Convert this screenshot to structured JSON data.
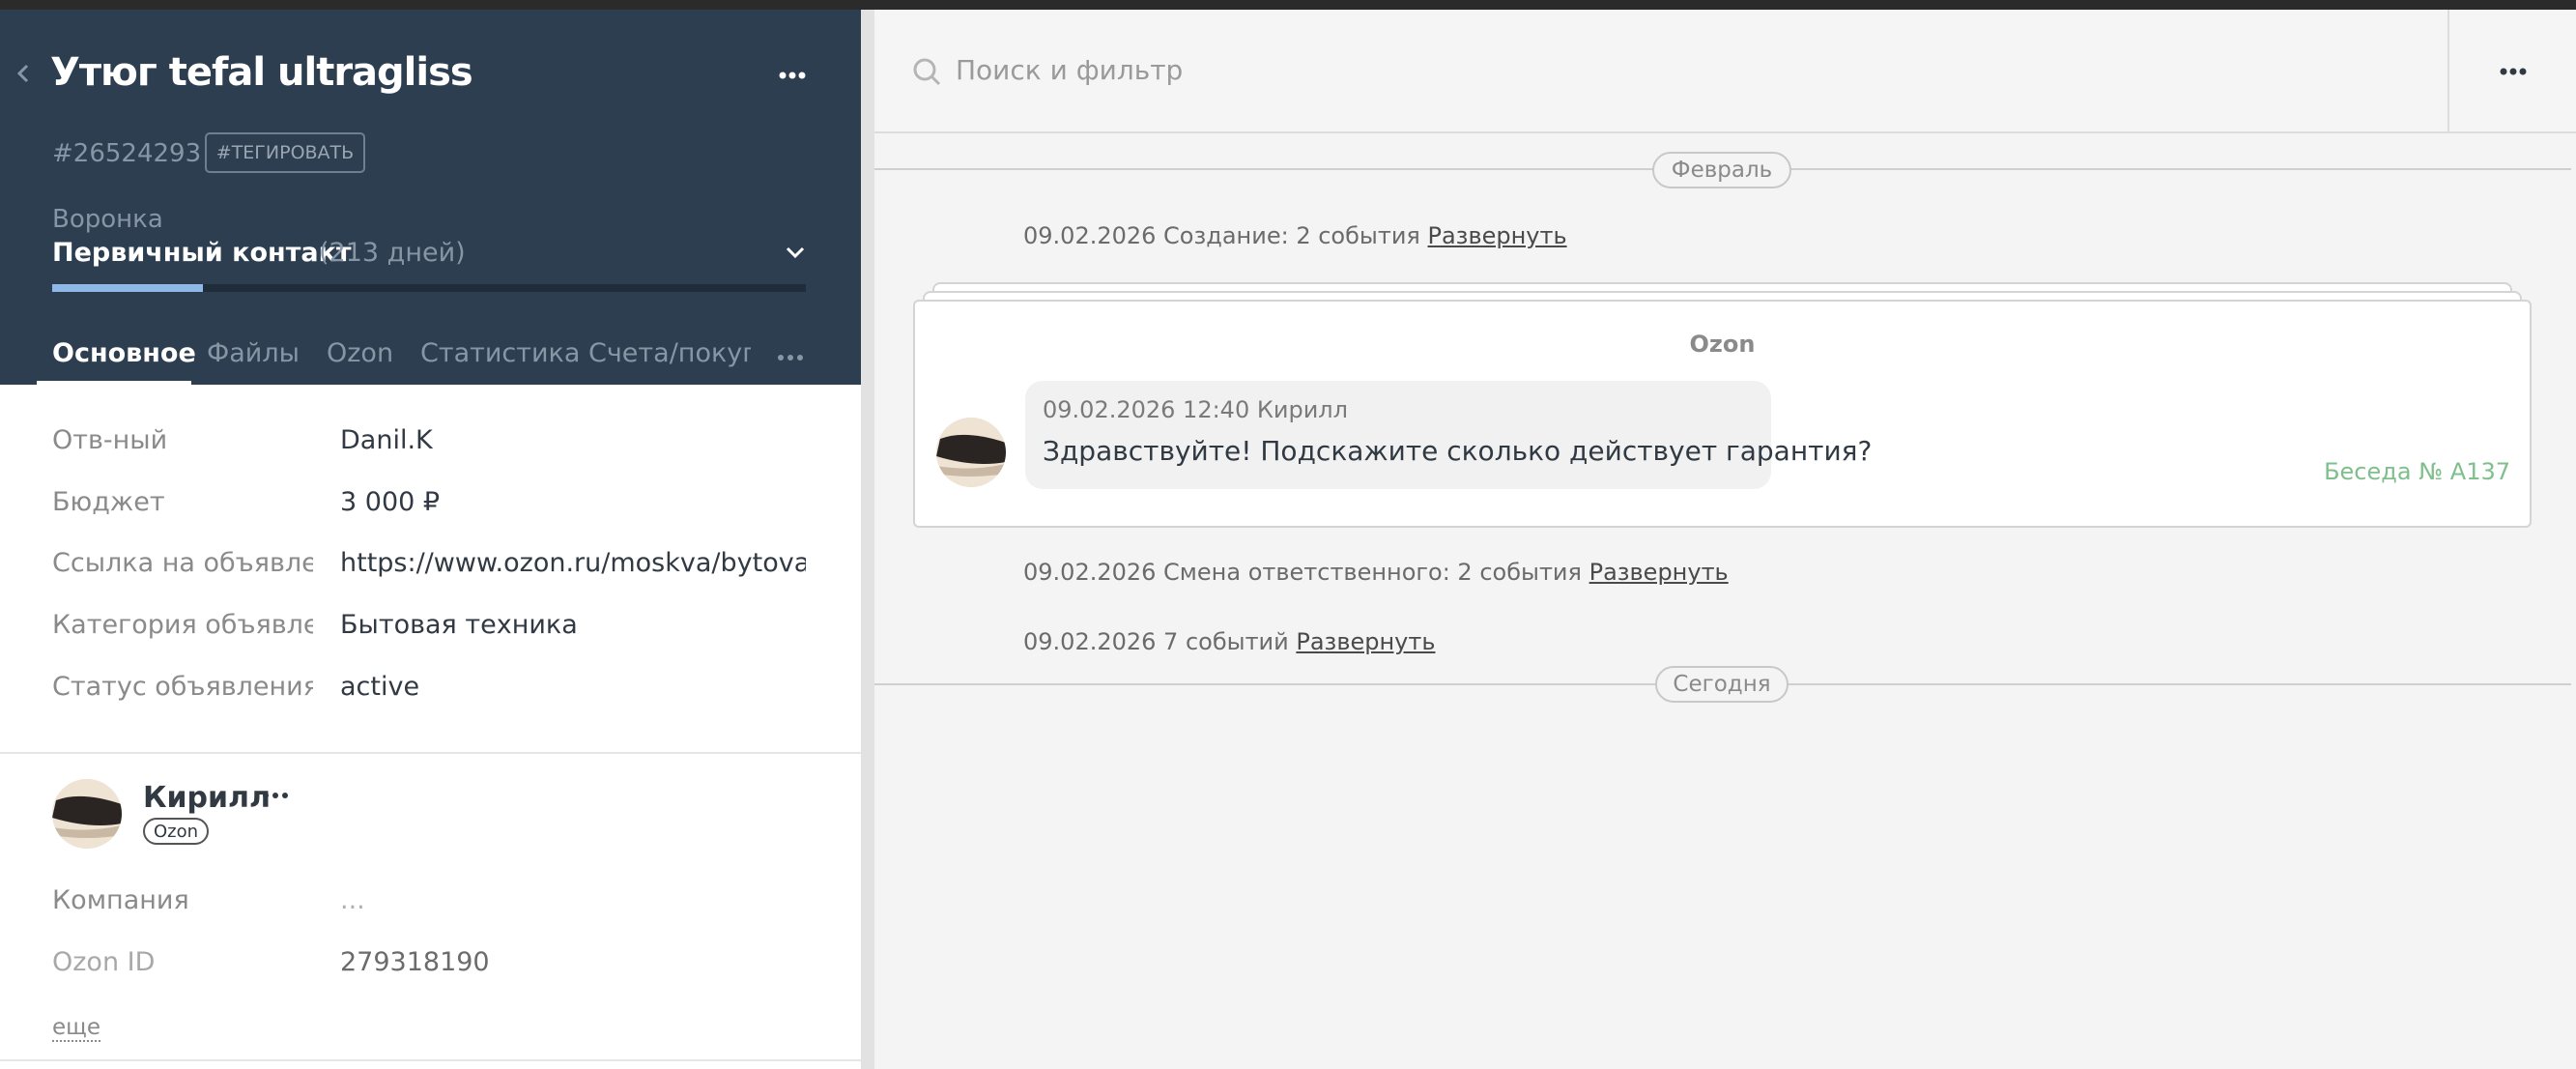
{
  "lead": {
    "title": "Утюг tefal ultragliss",
    "id": "#26524293",
    "tag_button": "#ТЕГИРОВАТЬ",
    "pipeline_label": "Воронка",
    "pipeline_stage": "Первичный контакт",
    "pipeline_days": "(213 дней)",
    "stage_progress": 0.2
  },
  "tabs": [
    {
      "label": "Основное",
      "active": true
    },
    {
      "label": "Файлы"
    },
    {
      "label": "Ozon"
    },
    {
      "label": "Статистика"
    },
    {
      "label": "Счета/покупки"
    }
  ],
  "fields": [
    {
      "label": "Отв-ный",
      "value": "Danil.K"
    },
    {
      "label": "Бюджет",
      "value": "3 000  ₽"
    },
    {
      "label": "Ссылка на объявление",
      "value": "https://www.ozon.ru/moskva/bytovaya"
    },
    {
      "label": "Категория объявления",
      "value": "Бытовая техника"
    },
    {
      "label": "Статус объявления",
      "value": "active"
    }
  ],
  "contact": {
    "name": "Кирилл",
    "source_badge": "Ozon",
    "fields": [
      {
        "label": "Компания",
        "value": "..."
      },
      {
        "label": "Ozon ID",
        "value": "279318190"
      }
    ],
    "more_link": "еще"
  },
  "feed": {
    "search_placeholder": "Поиск и фильтр",
    "month_label": "Февраль",
    "today_label": "Сегодня",
    "events": [
      {
        "text": "09.02.2026 Создание: 2 события ",
        "link": "Развернуть"
      },
      {
        "text": "09.02.2026 Смена ответственного: 2 события ",
        "link": "Развернуть"
      },
      {
        "text": "09.02.2026 7 событий ",
        "link": "Развернуть"
      }
    ],
    "chat": {
      "source": "Ozon",
      "meta": "09.02.2026 12:40 Кирилл",
      "message": "Здравствуйте! Подскажите сколько действует гарантия?",
      "conversation": "Беседа № A137"
    }
  },
  "colors": {
    "header_bg": "#2c3e50",
    "progress": "#8fb8e8",
    "conversation_link": "#7fbf8c"
  }
}
